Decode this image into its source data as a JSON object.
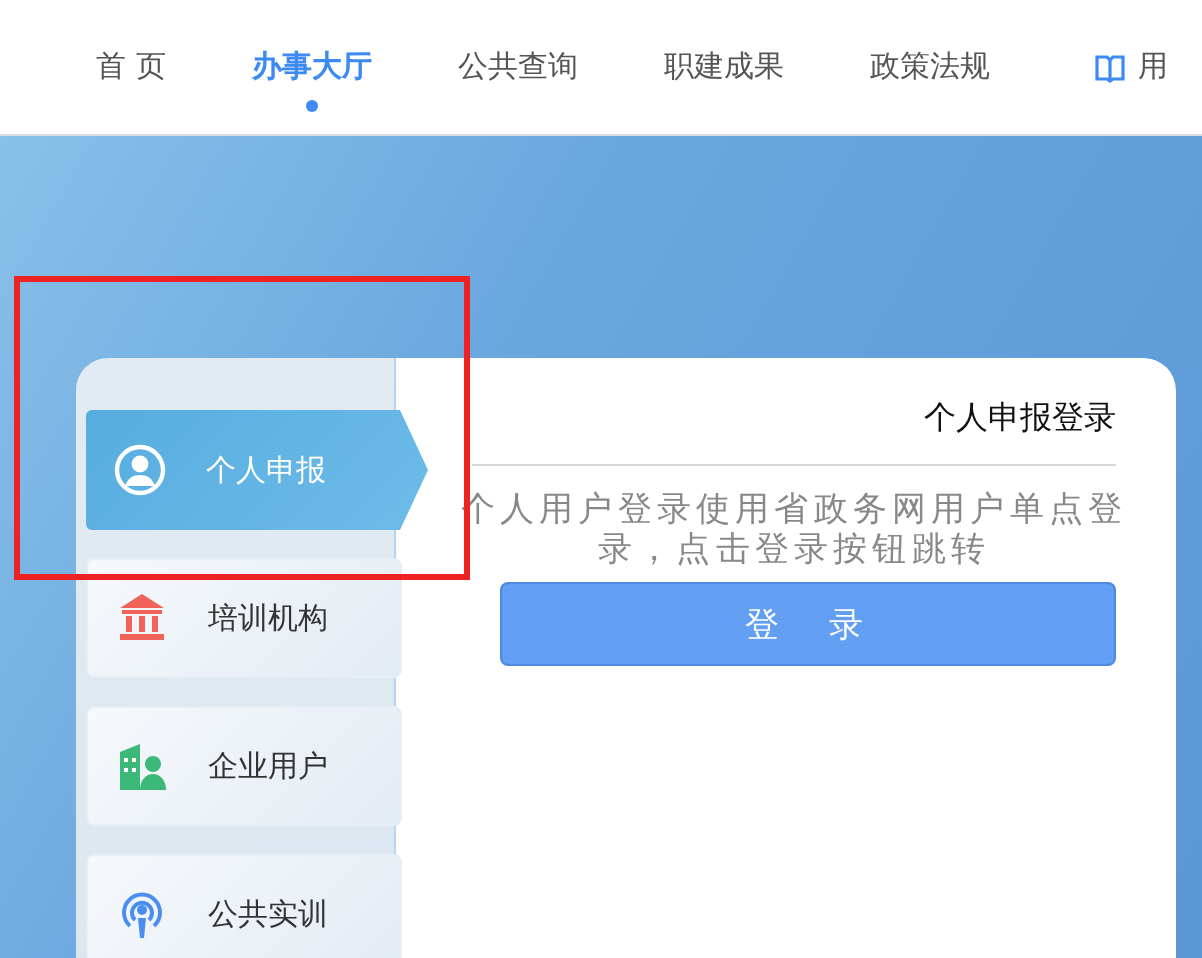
{
  "nav": {
    "items": [
      {
        "label": "首 页",
        "selected": false
      },
      {
        "label": "办事大厅",
        "selected": true
      },
      {
        "label": "公共查询",
        "selected": false
      },
      {
        "label": "职建成果",
        "selected": false
      },
      {
        "label": "政策法规",
        "selected": false
      }
    ],
    "extra_link": "用"
  },
  "login_card": {
    "tabs": [
      {
        "label": "个人申报",
        "selected": true
      },
      {
        "label": "培训机构",
        "selected": false
      },
      {
        "label": "企业用户",
        "selected": false
      },
      {
        "label": "公共实训",
        "selected": false
      }
    ],
    "title": "个人申报登录",
    "description": "个人用户登录使用省政务网用户单点登录，点击登录按钮跳转",
    "login_button": "登　录"
  }
}
